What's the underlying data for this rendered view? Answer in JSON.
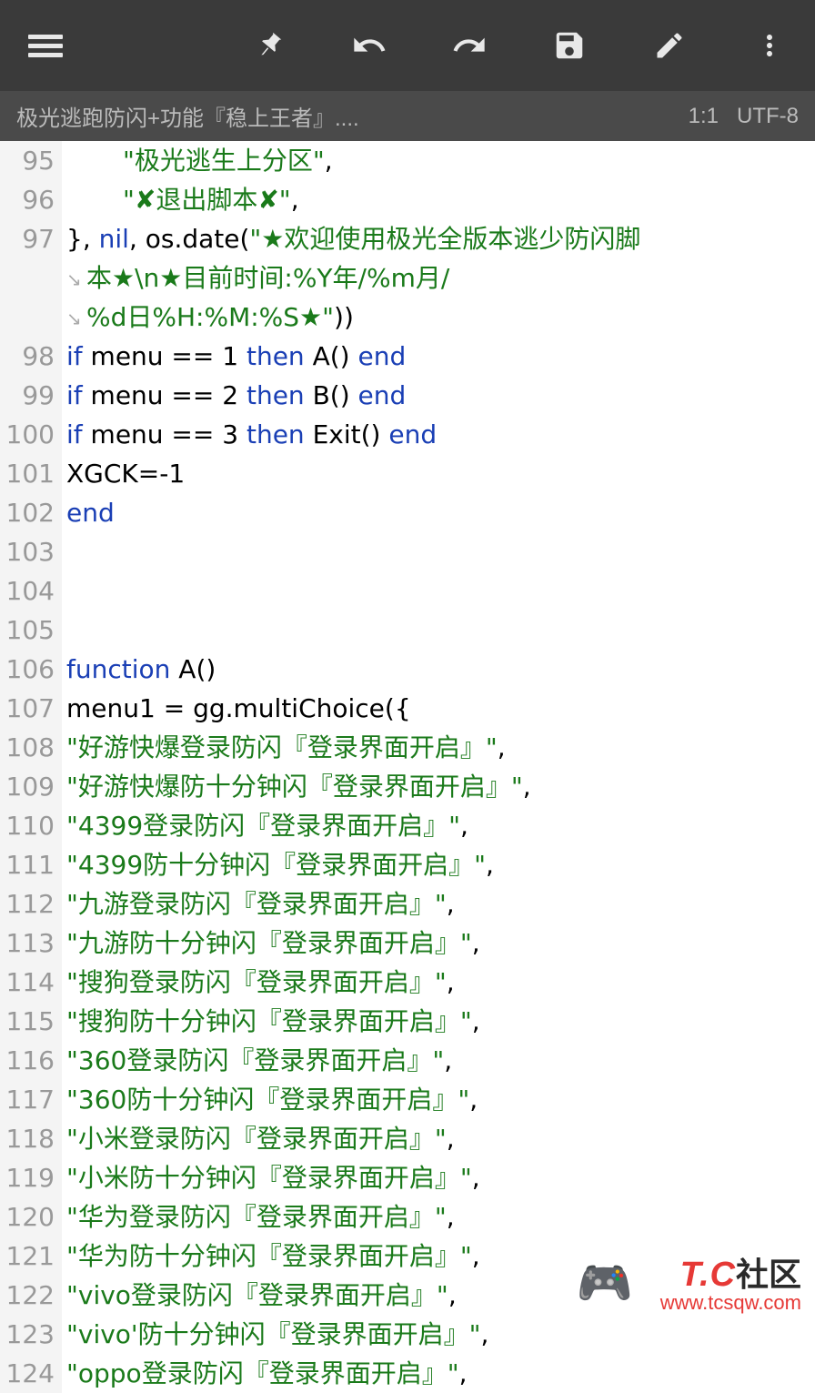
{
  "toolbar": {
    "menu": "menu",
    "pin": "pin",
    "undo": "undo",
    "redo": "redo",
    "save": "save",
    "edit": "edit",
    "more": "more"
  },
  "subbar": {
    "filename": "极光逃跑防闪+功能『稳上王者』....",
    "cursor": "1:1",
    "encoding": "UTF-8"
  },
  "lines": [
    {
      "n": 95,
      "tokens": [
        {
          "t": "\"极光逃生上分区\"",
          "c": "str"
        },
        {
          "t": ",",
          "c": "cls"
        }
      ],
      "ind": 1
    },
    {
      "n": 96,
      "tokens": [
        {
          "t": "\"✘退出脚本✘\"",
          "c": "str"
        },
        {
          "t": ",",
          "c": "cls"
        }
      ],
      "ind": 1
    },
    {
      "n": 97,
      "tokens": [
        {
          "t": "}, ",
          "c": "cls"
        },
        {
          "t": "nil",
          "c": "kw"
        },
        {
          "t": ", os.date(",
          "c": "cls"
        },
        {
          "t": "\"★欢迎使用极光全版本逃少防闪脚",
          "c": "str"
        }
      ]
    },
    {
      "n": null,
      "tokens": [
        {
          "t": "本★\\n★目前时间:%Y年/%m月/",
          "c": "str"
        }
      ],
      "wrap": true
    },
    {
      "n": null,
      "tokens": [
        {
          "t": "%d日%H:%M:%S★\"",
          "c": "str"
        },
        {
          "t": "))",
          "c": "cls"
        }
      ],
      "wrap": true
    },
    {
      "n": 98,
      "tokens": [
        {
          "t": "if",
          "c": "kw"
        },
        {
          "t": " menu == 1 ",
          "c": "cls"
        },
        {
          "t": "then",
          "c": "kw"
        },
        {
          "t": " A() ",
          "c": "cls"
        },
        {
          "t": "end",
          "c": "kw"
        }
      ]
    },
    {
      "n": 99,
      "tokens": [
        {
          "t": "if",
          "c": "kw"
        },
        {
          "t": " menu == 2 ",
          "c": "cls"
        },
        {
          "t": "then",
          "c": "kw"
        },
        {
          "t": " B() ",
          "c": "cls"
        },
        {
          "t": "end",
          "c": "kw"
        }
      ]
    },
    {
      "n": 100,
      "tokens": [
        {
          "t": "if",
          "c": "kw"
        },
        {
          "t": " menu == 3 ",
          "c": "cls"
        },
        {
          "t": "then",
          "c": "kw"
        },
        {
          "t": " Exit() ",
          "c": "cls"
        },
        {
          "t": "end",
          "c": "kw"
        }
      ]
    },
    {
      "n": 101,
      "tokens": [
        {
          "t": "XGCK=-1",
          "c": "cls"
        }
      ]
    },
    {
      "n": 102,
      "tokens": [
        {
          "t": "end",
          "c": "kw"
        }
      ]
    },
    {
      "n": 103,
      "tokens": []
    },
    {
      "n": 104,
      "tokens": []
    },
    {
      "n": 105,
      "tokens": []
    },
    {
      "n": 106,
      "tokens": [
        {
          "t": "function",
          "c": "kw"
        },
        {
          "t": " A()",
          "c": "cls"
        }
      ]
    },
    {
      "n": 107,
      "tokens": [
        {
          "t": "menu1 = gg.multiChoice({",
          "c": "cls"
        }
      ]
    },
    {
      "n": 108,
      "tokens": [
        {
          "t": "\"好游快爆登录防闪『登录界面开启』\"",
          "c": "str"
        },
        {
          "t": ",",
          "c": "cls"
        }
      ]
    },
    {
      "n": 109,
      "tokens": [
        {
          "t": "\"好游快爆防十分钟闪『登录界面开启』\"",
          "c": "str"
        },
        {
          "t": ",",
          "c": "cls"
        }
      ]
    },
    {
      "n": 110,
      "tokens": [
        {
          "t": "\"4399登录防闪『登录界面开启』\"",
          "c": "str"
        },
        {
          "t": ",",
          "c": "cls"
        }
      ]
    },
    {
      "n": 111,
      "tokens": [
        {
          "t": "\"4399防十分钟闪『登录界面开启』\"",
          "c": "str"
        },
        {
          "t": ",",
          "c": "cls"
        }
      ]
    },
    {
      "n": 112,
      "tokens": [
        {
          "t": "\"九游登录防闪『登录界面开启』\"",
          "c": "str"
        },
        {
          "t": ",",
          "c": "cls"
        }
      ]
    },
    {
      "n": 113,
      "tokens": [
        {
          "t": "\"九游防十分钟闪『登录界面开启』\"",
          "c": "str"
        },
        {
          "t": ",",
          "c": "cls"
        }
      ]
    },
    {
      "n": 114,
      "tokens": [
        {
          "t": "\"搜狗登录防闪『登录界面开启』\"",
          "c": "str"
        },
        {
          "t": ",",
          "c": "cls"
        }
      ]
    },
    {
      "n": 115,
      "tokens": [
        {
          "t": "\"搜狗防十分钟闪『登录界面开启』\"",
          "c": "str"
        },
        {
          "t": ",",
          "c": "cls"
        }
      ]
    },
    {
      "n": 116,
      "tokens": [
        {
          "t": "\"360登录防闪『登录界面开启』\"",
          "c": "str"
        },
        {
          "t": ",",
          "c": "cls"
        }
      ]
    },
    {
      "n": 117,
      "tokens": [
        {
          "t": "\"360防十分钟闪『登录界面开启』\"",
          "c": "str"
        },
        {
          "t": ",",
          "c": "cls"
        }
      ]
    },
    {
      "n": 118,
      "tokens": [
        {
          "t": "\"小米登录防闪『登录界面开启』\"",
          "c": "str"
        },
        {
          "t": ",",
          "c": "cls"
        }
      ]
    },
    {
      "n": 119,
      "tokens": [
        {
          "t": "\"小米防十分钟闪『登录界面开启』\"",
          "c": "str"
        },
        {
          "t": ",",
          "c": "cls"
        }
      ]
    },
    {
      "n": 120,
      "tokens": [
        {
          "t": "\"华为登录防闪『登录界面开启』\"",
          "c": "str"
        },
        {
          "t": ",",
          "c": "cls"
        }
      ]
    },
    {
      "n": 121,
      "tokens": [
        {
          "t": "\"华为防十分钟闪『登录界面开启』\"",
          "c": "str"
        },
        {
          "t": ",",
          "c": "cls"
        }
      ]
    },
    {
      "n": 122,
      "tokens": [
        {
          "t": "\"vivo登录防闪『登录界面开启』\"",
          "c": "str"
        },
        {
          "t": ",",
          "c": "cls"
        }
      ]
    },
    {
      "n": 123,
      "tokens": [
        {
          "t": "\"vivo'防十分钟闪『登录界面开启』\"",
          "c": "str"
        },
        {
          "t": ",",
          "c": "cls"
        }
      ]
    },
    {
      "n": 124,
      "tokens": [
        {
          "t": "\"oppo登录防闪『登录界面开启』\"",
          "c": "str"
        },
        {
          "t": ",",
          "c": "cls"
        }
      ]
    }
  ],
  "watermark": {
    "tc": "T.C",
    "sq": "社区",
    "url": "www.tcsqw.com"
  }
}
